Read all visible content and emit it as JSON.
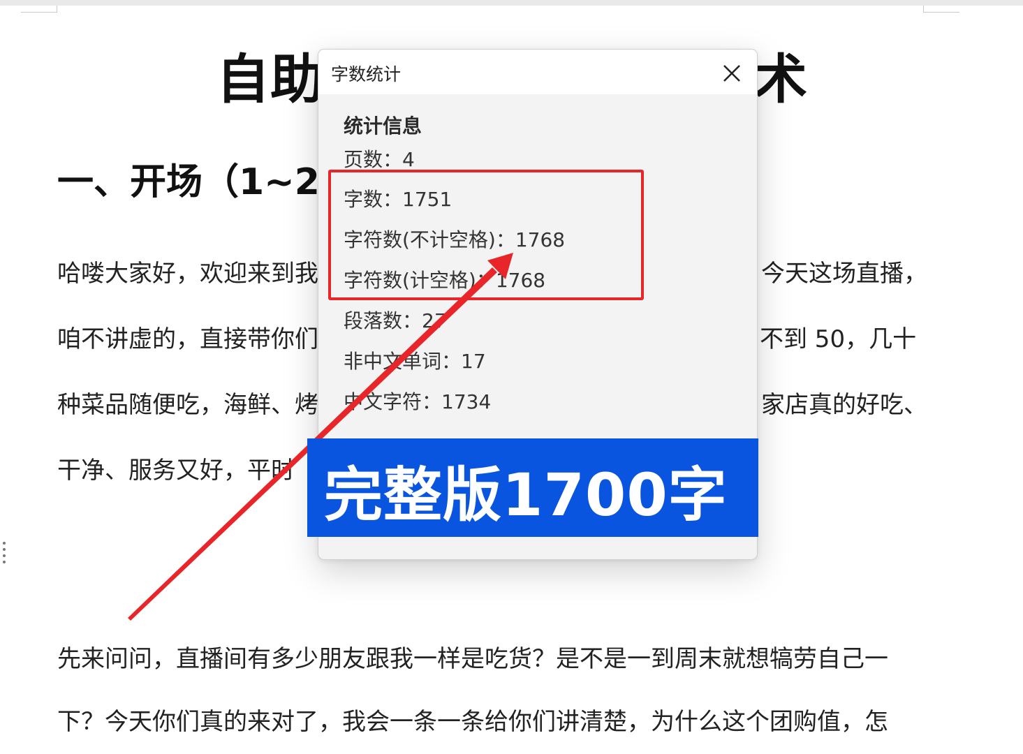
{
  "document": {
    "title": "自助餐本地团购直播话术",
    "heading1": "一、开场（1~2",
    "lines": [
      "哈喽大家好，欢迎来到我",
      "今天这场直播，",
      "咱不讲虚的，直接带你们",
      "不到 50，几十",
      "种菜品随便吃，海鲜、烤",
      "家店真的好吃、",
      "干净、服务又好，平时",
      "先来问问，直播间有多少朋友跟我一样是吃货？是不是一到周末就想犒劳自己一",
      "下？今天你们真的来对了，我会一条一条给你们讲清楚，为什么这个团购值，怎"
    ]
  },
  "dialog": {
    "title": "字数统计",
    "close_icon": "close-icon",
    "section_title": "统计信息",
    "stats": [
      {
        "label": "页数",
        "value": "4",
        "text": "页数：4"
      },
      {
        "label": "字数",
        "value": "1751",
        "text": "字数：1751"
      },
      {
        "label": "字符数(不计空格)",
        "value": "1768",
        "text": "字符数(不计空格)：1768"
      },
      {
        "label": "字符数(计空格)",
        "value": "1768",
        "text": "字符数(计空格)：1768"
      },
      {
        "label": "段落数",
        "value": "27",
        "text": "段落数：27"
      },
      {
        "label": "非中文单词",
        "value": "17",
        "text": "非中文单词：17"
      },
      {
        "label": "中文字符",
        "value": "1734",
        "text": "中文字符：1734"
      }
    ]
  },
  "overlay": {
    "banner_text": "完整版1700字",
    "banner_color": "#0a55e0",
    "highlight_color": "#e8262a",
    "arrow_color": "#e8262a"
  }
}
